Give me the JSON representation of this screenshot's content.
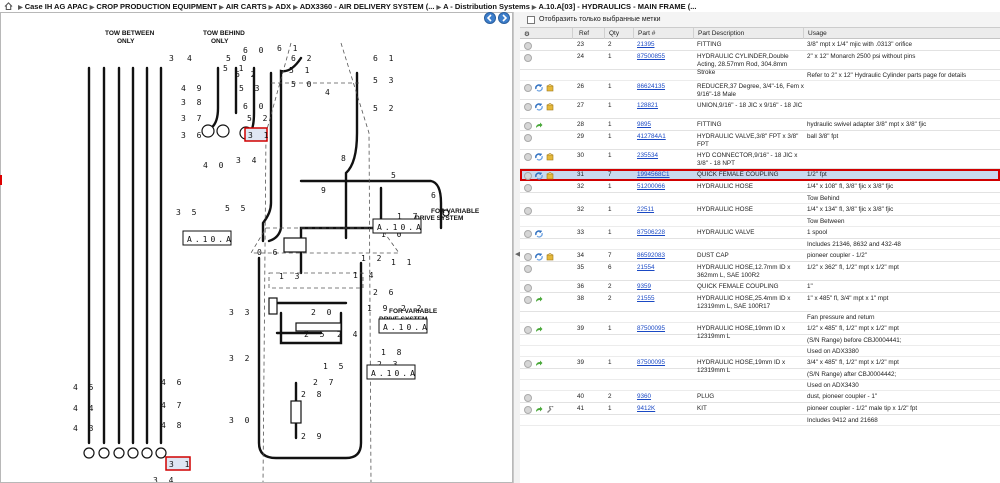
{
  "breadcrumb": [
    "Case IH AG APAC",
    "CROP PRODUCTION EQUIPMENT",
    "AIR CARTS",
    "ADX",
    "ADX3360 - AIR DELIVERY SYSTEM (...",
    "A - Distribution Systems",
    "A.10.A[03] - HYDRAULICS - MAIN FRAME (..."
  ],
  "diagram": {
    "title_tow_between": "TOW BETWEEN ONLY",
    "title_tow_behind": "TOW BEHIND ONLY",
    "for_variable": "FOR VARIABLE DRIVE SYSTEM",
    "ref_a10a": "A.10.A",
    "highlight_31": "31",
    "labels": [
      "3",
      "4",
      "1",
      "2",
      "5",
      "6",
      "7",
      "8",
      "9",
      "10",
      "11",
      "12",
      "13",
      "14",
      "15",
      "16",
      "17",
      "18",
      "19",
      "20",
      "21",
      "22",
      "23",
      "24",
      "25",
      "26",
      "27",
      "28",
      "29",
      "30",
      "32",
      "33",
      "34",
      "35",
      "36",
      "37",
      "38",
      "39",
      "40",
      "41",
      "42",
      "43",
      "44",
      "45",
      "46",
      "47",
      "48",
      "49",
      "50",
      "51",
      "52",
      "53",
      "55",
      "60"
    ]
  },
  "grid": {
    "filter_label": "Отобразить только выбранные метки",
    "headers": {
      "ref": "Ref",
      "qty": "Qty",
      "part": "Part #",
      "desc": "Part Description",
      "usage": "Usage"
    },
    "rows": [
      {
        "ref": "23",
        "qty": "2",
        "part": "21395",
        "desc": "FITTING",
        "usage": "3/8\" mpt x 1/4\" mjic with .0313\" orifice",
        "icons": [
          "circ"
        ]
      },
      {
        "ref": "24",
        "qty": "1",
        "part": "87500855",
        "desc": "HYDRAULIC CYLINDER,Double Acting, 28.57mm Rod, 304.8mm Stroke",
        "usage": "2\" x 12\" Monarch 2500 psi without pins",
        "icons": [
          "circ"
        ]
      },
      {
        "note": "Refer to 2\" x 12\" Hydraulic Cylinder parts page for details"
      },
      {
        "ref": "26",
        "qty": "1",
        "part": "86624135",
        "desc": "REDUCER,37 Degree, 3/4\"-16, Fem x 9/16\"-18 Male",
        "usage": "",
        "icons": [
          "circ",
          "blue",
          "box"
        ]
      },
      {
        "ref": "27",
        "qty": "1",
        "part": "128821",
        "desc": "UNION,9/16\" - 18 JIC x 9/16\" - 18 JIC",
        "usage": "",
        "icons": [
          "circ",
          "blue",
          "box"
        ]
      },
      {
        "ref": "28",
        "qty": "1",
        "part": "9895",
        "desc": "FITTING",
        "usage": "hydraulic swivel adapter 3/8\" mpt x 3/8\" fjic",
        "icons": [
          "circ",
          "green"
        ]
      },
      {
        "ref": "29",
        "qty": "1",
        "part": "412784A1",
        "desc": "HYDRAULIC VALVE,3/8\" FPT x 3/8\" FPT",
        "usage": "ball 3/8\" fpt",
        "icons": [
          "circ"
        ]
      },
      {
        "ref": "30",
        "qty": "1",
        "part": "235534",
        "desc": "HYD CONNECTOR,9/16\" - 18 JIC x 3/8\" - 18 NPT",
        "usage": "",
        "icons": [
          "circ",
          "blue",
          "box"
        ]
      },
      {
        "ref": "31",
        "qty": "7",
        "part": "1994568C1",
        "desc": "QUICK FEMALE COUPLING",
        "usage": "1/2\" fpt",
        "icons": [
          "circ",
          "blue",
          "box"
        ],
        "selected": true
      },
      {
        "ref": "32",
        "qty": "1",
        "part": "51200066",
        "desc": "HYDRAULIC HOSE",
        "usage": "1/4\" x 108\" fl, 3/8\" fjic x 3/8\" fjic",
        "icons": [
          "circ"
        ]
      },
      {
        "note": "Tow Behind"
      },
      {
        "ref": "32",
        "qty": "1",
        "part": "22511",
        "desc": "HYDRAULIC HOSE",
        "usage": "1/4\" x 134\" fl, 3/8\" fjic x 3/8\" fjic",
        "icons": [
          "circ"
        ]
      },
      {
        "note": "Tow Between"
      },
      {
        "ref": "33",
        "qty": "1",
        "part": "87506228",
        "desc": "HYDRAULIC VALVE",
        "usage": "1 spool",
        "icons": [
          "circ",
          "blue"
        ]
      },
      {
        "note": "Includes 21346, 8632 and 432-48"
      },
      {
        "ref": "34",
        "qty": "7",
        "part": "86592083",
        "desc": "DUST CAP",
        "usage": "pioneer coupler - 1/2\"",
        "icons": [
          "circ",
          "blue",
          "box"
        ]
      },
      {
        "ref": "35",
        "qty": "6",
        "part": "21554",
        "desc": "HYDRAULIC HOSE,12.7mm ID x 362mm L, SAE 100R2",
        "usage": "1/2\" x 362\" fl, 1/2\" mpt x 1/2\" mpt",
        "icons": [
          "circ"
        ]
      },
      {
        "ref": "36",
        "qty": "2",
        "part": "9359",
        "desc": "QUICK FEMALE COUPLING",
        "usage": "1\"",
        "icons": [
          "circ"
        ]
      },
      {
        "ref": "38",
        "qty": "2",
        "part": "21555",
        "desc": "HYDRAULIC HOSE,25.4mm ID x 12319mm L, SAE 100R17",
        "usage": "1\" x 485\" fl, 3/4\" mpt x 1\" mpt",
        "icons": [
          "circ",
          "green"
        ]
      },
      {
        "note": "Fan pressure and return"
      },
      {
        "ref": "39",
        "qty": "1",
        "part": "87500095",
        "desc": "HYDRAULIC HOSE,19mm ID x 12319mm L",
        "usage": "1/2\" x 485\" fl, 1/2\" mpt x 1/2\" mpt",
        "icons": [
          "circ",
          "green"
        ]
      },
      {
        "note": "(S/N Range) before CBJ0004441;"
      },
      {
        "note": "Used on ADX3380"
      },
      {
        "ref": "39",
        "qty": "1",
        "part": "87500095",
        "desc": "HYDRAULIC HOSE,19mm ID x 12319mm L",
        "usage": "3/4\" x 485\" fl, 1/2\" mpt x 1/2\" mpt",
        "icons": [
          "circ",
          "green"
        ]
      },
      {
        "note": "(S/N Range) after CBJ0004442;"
      },
      {
        "note": "Used on ADX3430"
      },
      {
        "ref": "40",
        "qty": "2",
        "part": "9360",
        "desc": "PLUG",
        "usage": "dust, pioneer coupler - 1\"",
        "icons": [
          "circ"
        ]
      },
      {
        "ref": "41",
        "qty": "1",
        "part": "9412K",
        "desc": "KIT",
        "usage": "pioneer coupler - 1/2\" male tip x 1/2\" fpt",
        "icons": [
          "circ",
          "green",
          "wrench"
        ]
      },
      {
        "note": "Includes 9412 and 21668"
      }
    ]
  }
}
